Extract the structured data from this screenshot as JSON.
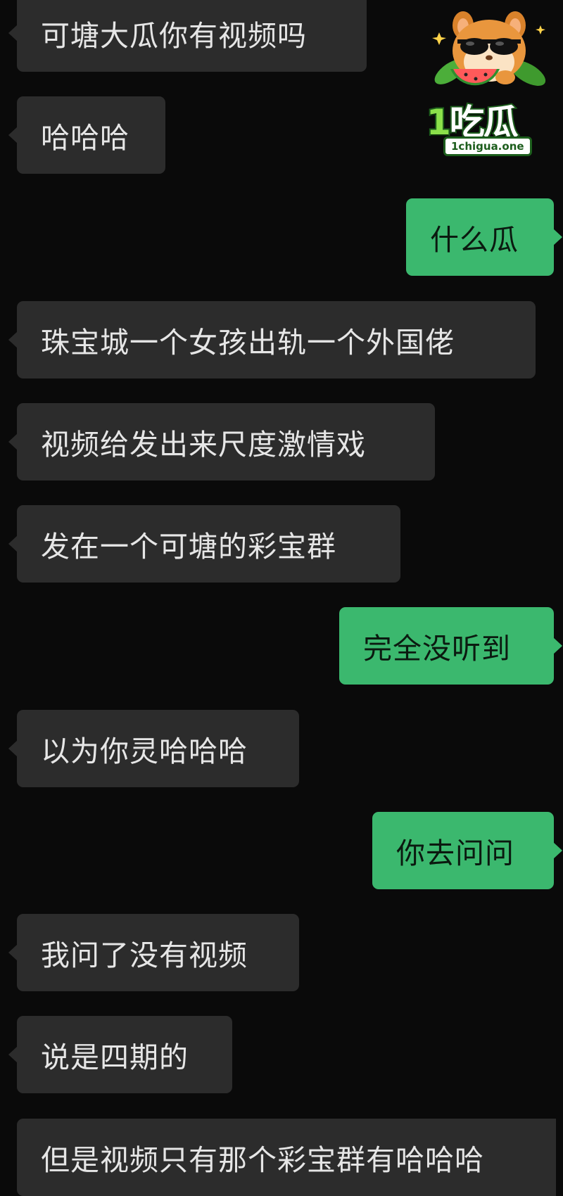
{
  "messages": [
    {
      "side": "in",
      "text": "可塘大瓜你有视频吗"
    },
    {
      "side": "in",
      "text": "哈哈哈"
    },
    {
      "side": "out",
      "text": "什么瓜"
    },
    {
      "side": "in",
      "text": "珠宝城一个女孩出轨一个外国佬"
    },
    {
      "side": "in",
      "text": "视频给发出来尺度激情戏"
    },
    {
      "side": "in",
      "text": "发在一个可塘的彩宝群"
    },
    {
      "side": "out",
      "text": "完全没听到"
    },
    {
      "side": "in",
      "text": "以为你灵哈哈哈"
    },
    {
      "side": "out",
      "text": "你去问问"
    },
    {
      "side": "in",
      "text": "我问了没有视频"
    },
    {
      "side": "in",
      "text": "说是四期的"
    },
    {
      "side": "in",
      "text": "但是视频只有那个彩宝群有哈哈哈"
    }
  ],
  "watermark": {
    "brand_number": "1",
    "brand_name": "吃瓜",
    "url": "1chigua.one"
  },
  "colors": {
    "background": "#0a0a0a",
    "incoming_bubble": "#2c2c2c",
    "outgoing_bubble": "#3bb86e",
    "incoming_text": "#e6e6e6",
    "outgoing_text": "#0b1a10"
  }
}
